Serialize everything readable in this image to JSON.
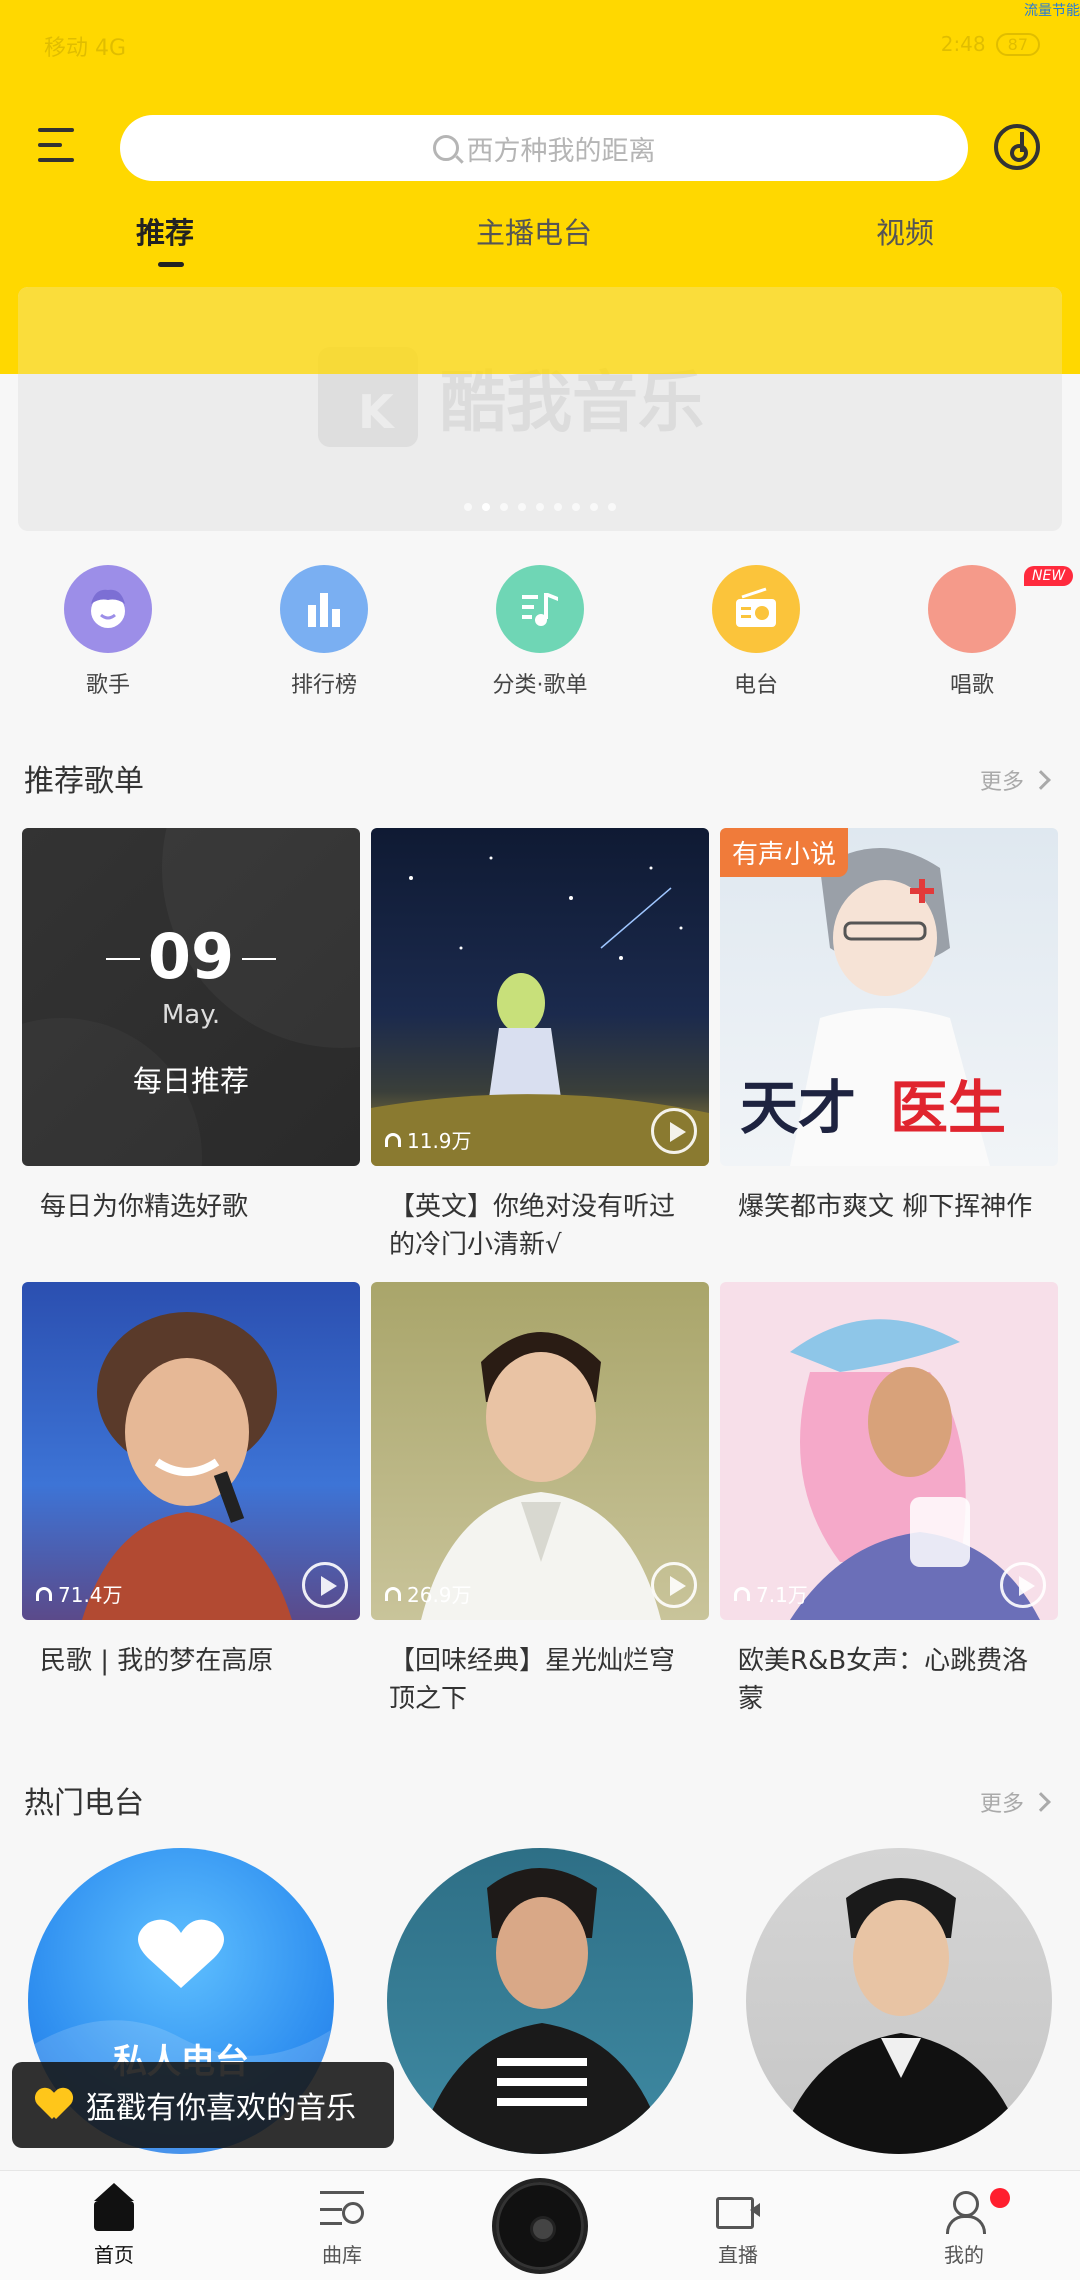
{
  "status_bar": {
    "corner_text": "流量节能",
    "left_text": "移动 4G",
    "right_text": "2:48",
    "battery": "87"
  },
  "search": {
    "placeholder": "西方种我的距离"
  },
  "tabs": [
    {
      "label": "推荐"
    },
    {
      "label": "主播电台"
    },
    {
      "label": "视频"
    }
  ],
  "banner": {
    "logo_text": "酷我音乐"
  },
  "categories": [
    {
      "label": "歌手",
      "color": "#9c8ee8",
      "icon": "singer-face-icon"
    },
    {
      "label": "排行榜",
      "color": "#7aaff2",
      "icon": "bar-chart-icon"
    },
    {
      "label": "分类·歌单",
      "color": "#6fd6b5",
      "icon": "playlist-note-icon"
    },
    {
      "label": "电台",
      "color": "#fbc43b",
      "icon": "radio-icon"
    },
    {
      "label": "唱歌",
      "color": "#f59a8a",
      "icon": "mic-icon"
    }
  ],
  "new_badge": "NEW",
  "recommend": {
    "title": "推荐歌单",
    "more": "更多",
    "daily": {
      "day": "09",
      "month": "May.",
      "label": "每日推荐"
    },
    "cards": [
      {
        "title": "每日为你精选好歌",
        "count": ""
      },
      {
        "title": "【英文】你绝对没有听过的冷门小清新√",
        "count": "11.9万"
      },
      {
        "title": "爆笑都市爽文 柳下挥神作",
        "count": "",
        "tag": "有声小说"
      },
      {
        "title": "民歌 | 我的梦在高原",
        "count": "71.4万"
      },
      {
        "title": "【回味经典】星光灿烂穹顶之下",
        "count": "26.9万"
      },
      {
        "title": "欧美R&B女声：心跳费洛蒙",
        "count": "7.1万"
      }
    ]
  },
  "radio": {
    "title": "热门电台",
    "more": "更多",
    "items": [
      {
        "label": "私人电台"
      },
      {
        "label": ""
      },
      {
        "label": ""
      }
    ]
  },
  "toast": {
    "text": "猛戳有你喜欢的音乐"
  },
  "bottom_nav": [
    {
      "label": "首页"
    },
    {
      "label": "曲库"
    },
    {
      "label": ""
    },
    {
      "label": "直播"
    },
    {
      "label": "我的"
    }
  ]
}
